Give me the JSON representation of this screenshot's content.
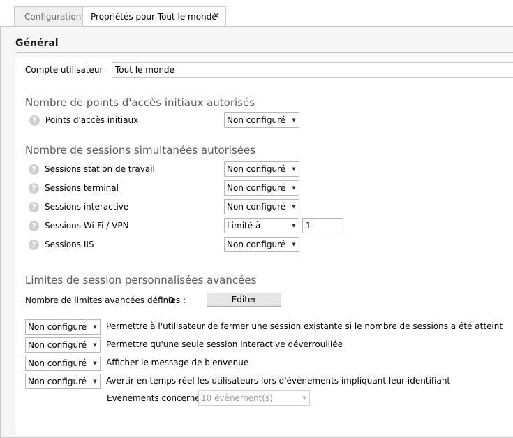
{
  "tabs": [
    {
      "label": "Configuration"
    },
    {
      "label": "Propriétés pour Tout le monde",
      "close": "✕"
    }
  ],
  "general": {
    "title": "Général",
    "account_label": "Compte utilisateur",
    "account_value": "Tout le monde"
  },
  "initial_points": {
    "title": "Nombre de points d'accès initiaux autorisés",
    "rows": [
      {
        "label": "Points d'accès initiaux",
        "value": "Non configuré"
      }
    ]
  },
  "sessions": {
    "title": "Nombre de sessions simultanées autorisées",
    "rows": [
      {
        "label": "Sessions station de travail",
        "value": "Non configuré"
      },
      {
        "label": "Sessions terminal",
        "value": "Non configuré"
      },
      {
        "label": "Sessions interactive",
        "value": "Non configuré"
      },
      {
        "label": "Sessions Wi-Fi / VPN",
        "value": "Limité à",
        "number": "1"
      },
      {
        "label": "Sessions IIS",
        "value": "Non configuré"
      }
    ]
  },
  "advanced": {
    "title": "Limites de session personnalisées avancées",
    "count_label": "Nombre de limites avancées définies :",
    "count_value": "0",
    "edit_button": "Editer",
    "options": [
      {
        "value": "Non configuré",
        "text": "Permettre à l'utilisateur de fermer une session existante si le nombre de sessions a été atteint"
      },
      {
        "value": "Non configuré",
        "text": "Permettre qu'une seule session interactive déverrouillée"
      },
      {
        "value": "Non configuré",
        "text": "Afficher le message de bienvenue"
      },
      {
        "value": "Non configuré",
        "text": "Avertir en temps réel les utilisateurs lors d'évènements impliquant leur identifiant"
      }
    ],
    "events_label": "Evènements concernés :",
    "events_value": "10 évènement(s)"
  },
  "icons": {
    "help": "help-question-icon",
    "dropdown": "chevron-down-icon",
    "help_glyph": "?",
    "arrow_glyph": "▼"
  }
}
